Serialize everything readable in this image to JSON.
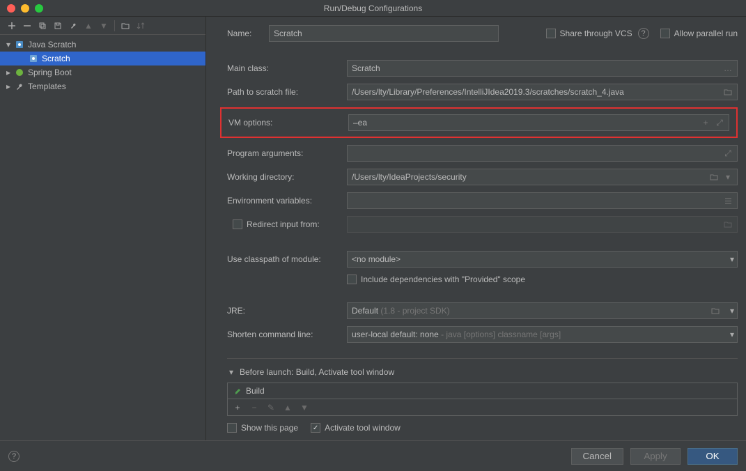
{
  "window": {
    "title": "Run/Debug Configurations"
  },
  "tree": {
    "items": [
      {
        "label": "Java Scratch",
        "icon": "java-scratch",
        "expanded": true
      },
      {
        "label": "Scratch",
        "icon": "application",
        "selected": true
      },
      {
        "label": "Spring Boot",
        "icon": "spring"
      },
      {
        "label": "Templates",
        "icon": "wrench"
      }
    ]
  },
  "top": {
    "name_label": "Name:",
    "name_value": "Scratch",
    "share_vcs": "Share through VCS",
    "allow_parallel": "Allow parallel run"
  },
  "form": {
    "main_class_label": "Main class:",
    "main_class_value": "Scratch",
    "path_label": "Path to scratch file:",
    "path_value": "/Users/lty/Library/Preferences/IntelliJIdea2019.3/scratches/scratch_4.java",
    "vm_label": "VM options:",
    "vm_value": "–ea",
    "prog_args_label": "Program arguments:",
    "prog_args_value": "",
    "workdir_label": "Working directory:",
    "workdir_value": "/Users/lty/IdeaProjects/security",
    "env_label": "Environment variables:",
    "env_value": "",
    "redirect_label": "Redirect input from:",
    "classpath_label": "Use classpath of module:",
    "classpath_value": "<no module>",
    "include_deps_label": "Include dependencies with \"Provided\" scope",
    "jre_label": "JRE:",
    "jre_value": "Default ",
    "jre_hint": "(1.8 - project SDK)",
    "shorten_label": "Shorten command line:",
    "shorten_value": "user-local default: none ",
    "shorten_hint": "- java [options] classname [args]"
  },
  "before_launch": {
    "header": "Before launch: Build, Activate tool window",
    "build": "Build",
    "show_page": "Show this page",
    "activate_window": "Activate tool window"
  },
  "buttons": {
    "cancel": "Cancel",
    "apply": "Apply",
    "ok": "OK"
  }
}
